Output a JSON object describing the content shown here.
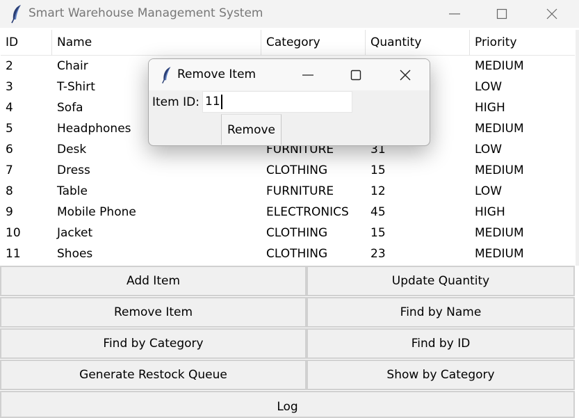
{
  "window": {
    "title": "Smart Warehouse Management System"
  },
  "table": {
    "columns": [
      "ID",
      "Name",
      "Category",
      "Quantity",
      "Priority"
    ],
    "rows": [
      {
        "id": "2",
        "name": "Chair",
        "category": "",
        "quantity": "",
        "priority": "MEDIUM"
      },
      {
        "id": "3",
        "name": "T-Shirt",
        "category": "",
        "quantity": "",
        "priority": "LOW"
      },
      {
        "id": "4",
        "name": "Sofa",
        "category": "",
        "quantity": "",
        "priority": "HIGH"
      },
      {
        "id": "5",
        "name": "Headphones",
        "category": "",
        "quantity": "",
        "priority": "MEDIUM"
      },
      {
        "id": "6",
        "name": "Desk",
        "category": "FURNITURE",
        "quantity": "31",
        "priority": "LOW"
      },
      {
        "id": "7",
        "name": "Dress",
        "category": "CLOTHING",
        "quantity": "15",
        "priority": "MEDIUM"
      },
      {
        "id": "8",
        "name": "Table",
        "category": "FURNITURE",
        "quantity": "12",
        "priority": "LOW"
      },
      {
        "id": "9",
        "name": "Mobile Phone",
        "category": "ELECTRONICS",
        "quantity": "45",
        "priority": "HIGH"
      },
      {
        "id": "10",
        "name": "Jacket",
        "category": "CLOTHING",
        "quantity": "15",
        "priority": "MEDIUM"
      },
      {
        "id": "11",
        "name": "Shoes",
        "category": "CLOTHING",
        "quantity": "23",
        "priority": "MEDIUM"
      }
    ]
  },
  "buttons": {
    "add_item": "Add Item",
    "update_quantity": "Update Quantity",
    "remove_item": "Remove Item",
    "find_by_name": "Find by Name",
    "find_by_category": "Find by Category",
    "find_by_id": "Find by ID",
    "generate_restock_queue": "Generate Restock Queue",
    "show_by_category": "Show by Category",
    "log": "Log"
  },
  "dialog": {
    "title": "Remove Item",
    "item_id_label": "Item ID:",
    "item_id_value": "11",
    "remove_button": "Remove"
  },
  "icons": {
    "app": "feather-icon",
    "minimize": "minimize-icon",
    "maximize": "maximize-icon",
    "close": "close-icon"
  }
}
